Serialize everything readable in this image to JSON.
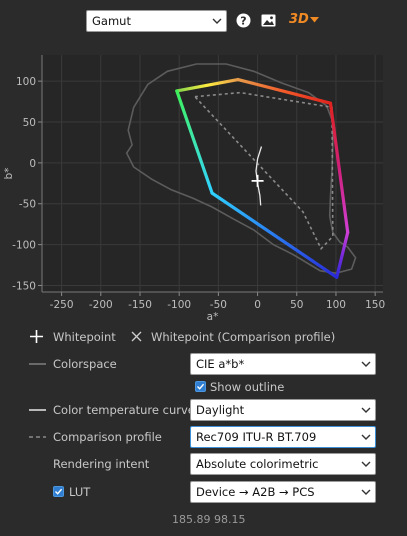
{
  "toolbar": {
    "mode_select": "Gamut",
    "help_icon": "help-icon",
    "image_icon": "image-icon",
    "three_d_label": "3D"
  },
  "chart_data": {
    "type": "scatter",
    "xlabel": "a*",
    "ylabel": "b*",
    "xlim": [
      -275,
      160
    ],
    "ylim": [
      -158,
      132
    ],
    "x_ticks": [
      "-250",
      "-200",
      "-150",
      "-100",
      "-50",
      "0",
      "50",
      "100",
      "150"
    ],
    "y_ticks": [
      "100",
      "50",
      "0",
      "-50",
      "-100",
      "-150"
    ],
    "grid": true,
    "series": [
      {
        "kind": "colorspace-outline",
        "points": [
          [
            -160,
            22
          ],
          [
            -165,
            40
          ],
          [
            -158,
            68
          ],
          [
            -140,
            96
          ],
          [
            -115,
            112
          ],
          [
            -78,
            121
          ],
          [
            -40,
            121
          ],
          [
            -5,
            112
          ],
          [
            30,
            98
          ],
          [
            65,
            86
          ],
          [
            88,
            70
          ],
          [
            96,
            50
          ],
          [
            96,
            20
          ],
          [
            95,
            -10
          ],
          [
            93,
            -40
          ],
          [
            92,
            -65
          ],
          [
            96,
            -85
          ],
          [
            105,
            -97
          ],
          [
            115,
            -103
          ],
          [
            125,
            -116
          ],
          [
            120,
            -130
          ],
          [
            100,
            -135
          ],
          [
            80,
            -132
          ],
          [
            45,
            -112
          ],
          [
            20,
            -100
          ],
          [
            -5,
            -82
          ],
          [
            -32,
            -68
          ],
          [
            -58,
            -54
          ],
          [
            -83,
            -43
          ],
          [
            -110,
            -33
          ],
          [
            -135,
            -20
          ],
          [
            -158,
            -5
          ],
          [
            -167,
            12
          ],
          [
            -160,
            22
          ]
        ]
      },
      {
        "kind": "display-gamut",
        "points": [
          [
            -103,
            88
          ],
          [
            -25,
            102
          ],
          [
            93,
            73
          ],
          [
            115,
            -85
          ],
          [
            101,
            -140
          ],
          [
            -58,
            -37
          ],
          [
            -103,
            88
          ]
        ]
      },
      {
        "kind": "comparison-gamut-dashed",
        "points": [
          [
            -80,
            81
          ],
          [
            -22,
            86
          ],
          [
            95,
            68
          ],
          [
            96,
            -90
          ],
          [
            81,
            -105
          ],
          [
            58,
            -60
          ],
          [
            -80,
            81
          ]
        ]
      },
      {
        "kind": "whitepoint",
        "points": [
          [
            0,
            -22
          ]
        ]
      },
      {
        "kind": "temperature-curve",
        "points": [
          [
            5,
            20
          ],
          [
            0,
            5
          ],
          [
            -2,
            -10
          ],
          [
            0,
            -25
          ],
          [
            3,
            -40
          ],
          [
            4,
            -52
          ]
        ]
      }
    ]
  },
  "legend": {
    "whitepoint": "Whitepoint",
    "whitepoint_comparison": "Whitepoint (Comparison profile)"
  },
  "form": {
    "colorspace_label": "Colorspace",
    "colorspace_value": "CIE a*b*",
    "show_outline_label": "Show outline",
    "show_outline_checked": true,
    "temp_curve_label": "Color temperature curve",
    "temp_curve_value": "Daylight",
    "comparison_label": "Comparison profile",
    "comparison_value": "Rec709 ITU-R BT.709",
    "intent_label": "Rendering intent",
    "intent_value": "Absolute colorimetric",
    "lut_label": "LUT",
    "lut_checked": true,
    "lut_value": "Device → A2B → PCS"
  },
  "readout": "185.89 98.15"
}
